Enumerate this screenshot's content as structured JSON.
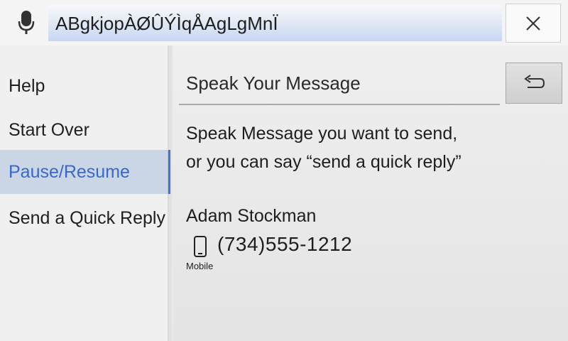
{
  "header": {
    "mic_icon": "microphone-icon",
    "query_text": "ABgkjopÀØÛÝÌqÅAgLgMnÏ",
    "close_icon": "close-icon"
  },
  "sidebar": {
    "items": [
      {
        "label": "Help",
        "active": false
      },
      {
        "label": "Start Over",
        "active": false
      },
      {
        "label": "Pause/Resume",
        "active": true
      },
      {
        "label": "Send a Quick Reply",
        "active": false
      }
    ],
    "active_color": "#3b68c6",
    "active_bg": "#cad6e6"
  },
  "main": {
    "title": "Speak Your Message",
    "back_icon": "return-arrow-icon",
    "instruction_line1": "Speak Message you want to send,",
    "instruction_line2": "or you can say  “send a quick reply”",
    "contact": {
      "name": "Adam Stockman",
      "phone_icon": "mobile-phone-icon",
      "phone": "(734)555-1212",
      "phone_type": "Mobile"
    }
  }
}
